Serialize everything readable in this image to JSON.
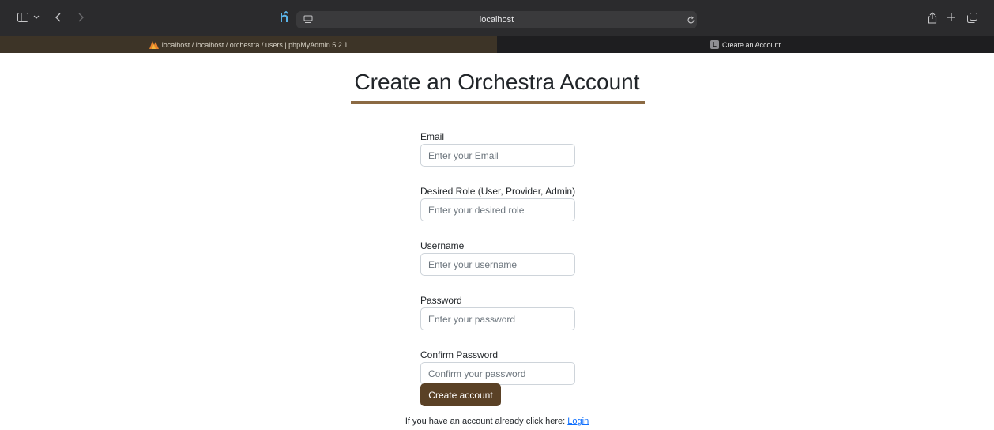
{
  "browser": {
    "address": "localhost",
    "tabs": [
      {
        "label": "localhost / localhost / orchestra / users | phpMyAdmin 5.2.1",
        "active": false
      },
      {
        "label": "Create an Account",
        "active": true,
        "favicon_letter": "L"
      }
    ],
    "close_glyph": "×",
    "icons": [
      "sidebar-icon",
      "chevron-down-icon",
      "back-icon",
      "forward-icon",
      "extension-icon",
      "page-settings-icon",
      "reload-icon",
      "share-icon",
      "new-tab-icon",
      "tab-overview-icon"
    ]
  },
  "page": {
    "title": "Create an Orchestra Account",
    "accent_color": "#8b6a43",
    "fields": [
      {
        "label": "Email",
        "placeholder": "Enter your Email"
      },
      {
        "label": "Desired Role (User, Provider, Admin)",
        "placeholder": "Enter your desired role"
      },
      {
        "label": "Username",
        "placeholder": "Enter your username"
      },
      {
        "label": "Password",
        "placeholder": "Enter your password"
      },
      {
        "label": "Confirm Password",
        "placeholder": "Confirm your password"
      }
    ],
    "submit_label": "Create account",
    "submit_color": "#5a4126",
    "footer_text": "If you have an account already click here: ",
    "login_link": "Login"
  }
}
